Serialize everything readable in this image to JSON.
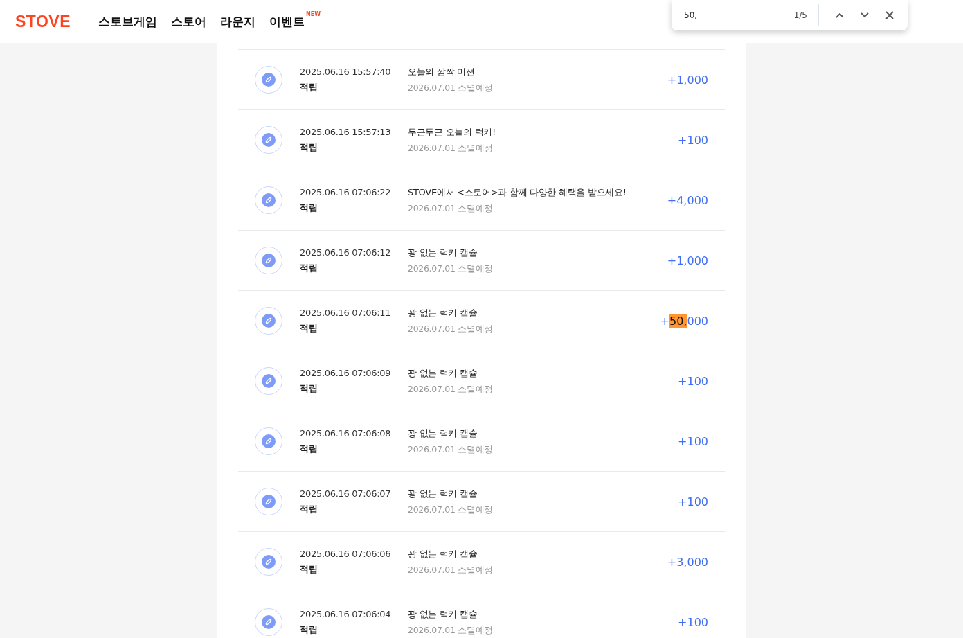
{
  "header": {
    "logo": "STOVE",
    "nav": [
      {
        "label": "스토브게임"
      },
      {
        "label": "스토어"
      },
      {
        "label": "라운지"
      },
      {
        "label": "이벤트",
        "badge": "NEW"
      }
    ]
  },
  "find_bar": {
    "value": "50,",
    "count": "1/5"
  },
  "rows": [
    {
      "datetime": "2025.06.16 15:57:40",
      "type": "적립",
      "title": "오늘의 깜짝 미션",
      "expiry": "2026.07.01 소멸예정",
      "amount_parts": [
        {
          "text": "+1,000",
          "highlighted": false
        }
      ]
    },
    {
      "datetime": "2025.06.16 15:57:13",
      "type": "적립",
      "title": "두근두근 오늘의 럭키!",
      "expiry": "2026.07.01 소멸예정",
      "amount_parts": [
        {
          "text": "+100",
          "highlighted": false
        }
      ]
    },
    {
      "datetime": "2025.06.16 07:06:22",
      "type": "적립",
      "title": "STOVE에서 <스토어>과 함께 다양한 혜택을 받으세요!",
      "expiry": "2026.07.01 소멸예정",
      "amount_parts": [
        {
          "text": "+4,000",
          "highlighted": false
        }
      ]
    },
    {
      "datetime": "2025.06.16 07:06:12",
      "type": "적립",
      "title": "꽝 없는 럭키 캡슐",
      "expiry": "2026.07.01 소멸예정",
      "amount_parts": [
        {
          "text": "+1,000",
          "highlighted": false
        }
      ]
    },
    {
      "datetime": "2025.06.16 07:06:11",
      "type": "적립",
      "title": "꽝 없는 럭키 캡슐",
      "expiry": "2026.07.01 소멸예정",
      "amount_parts": [
        {
          "text": "+",
          "highlighted": false
        },
        {
          "text": "50,",
          "highlighted": true
        },
        {
          "text": "000",
          "highlighted": false
        }
      ]
    },
    {
      "datetime": "2025.06.16 07:06:09",
      "type": "적립",
      "title": "꽝 없는 럭키 캡슐",
      "expiry": "2026.07.01 소멸예정",
      "amount_parts": [
        {
          "text": "+100",
          "highlighted": false
        }
      ]
    },
    {
      "datetime": "2025.06.16 07:06:08",
      "type": "적립",
      "title": "꽝 없는 럭키 캡슐",
      "expiry": "2026.07.01 소멸예정",
      "amount_parts": [
        {
          "text": "+100",
          "highlighted": false
        }
      ]
    },
    {
      "datetime": "2025.06.16 07:06:07",
      "type": "적립",
      "title": "꽝 없는 럭키 캡슐",
      "expiry": "2026.07.01 소멸예정",
      "amount_parts": [
        {
          "text": "+100",
          "highlighted": false
        }
      ]
    },
    {
      "datetime": "2025.06.16 07:06:06",
      "type": "적립",
      "title": "꽝 없는 럭키 캡슐",
      "expiry": "2026.07.01 소멸예정",
      "amount_parts": [
        {
          "text": "+3,000",
          "highlighted": false
        }
      ]
    },
    {
      "datetime": "2025.06.16 07:06:04",
      "type": "적립",
      "title": "꽝 없는 럭키 캡슐",
      "expiry": "2026.07.01 소멸예정",
      "amount_parts": [
        {
          "text": "+100",
          "highlighted": false
        }
      ]
    }
  ]
}
